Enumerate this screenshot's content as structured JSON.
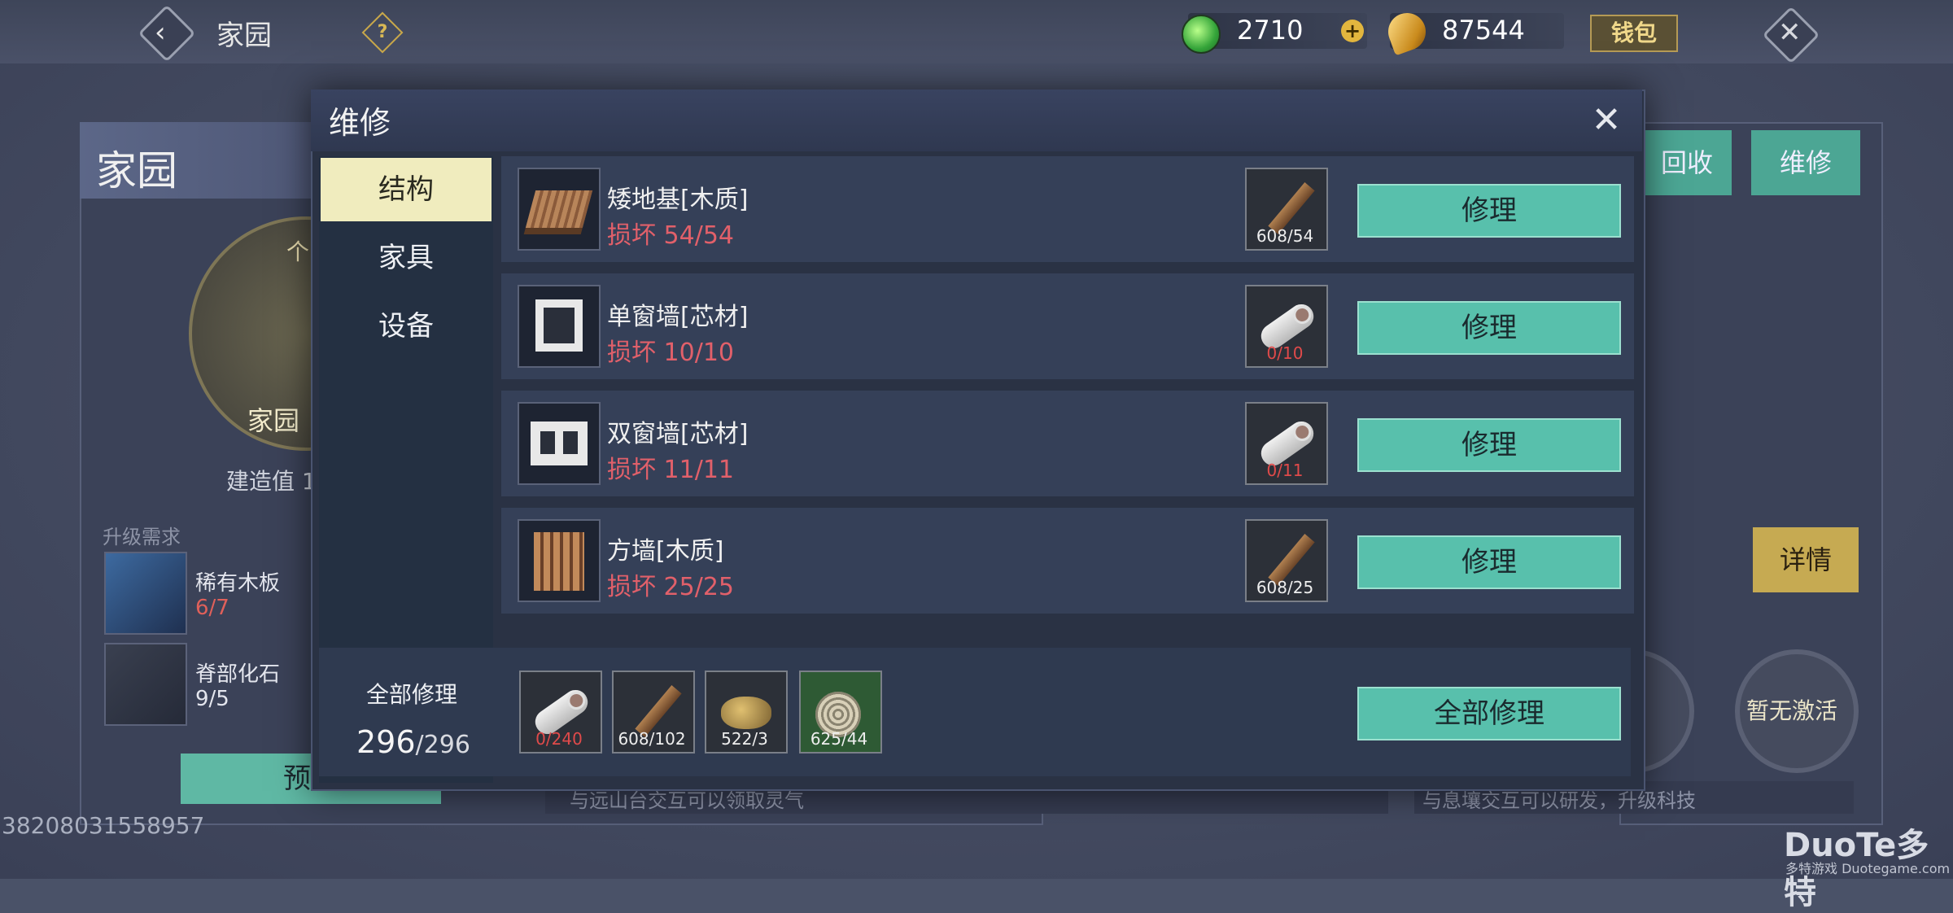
{
  "topbar": {
    "title": "家园",
    "help": "?",
    "jade": "2710",
    "add": "+",
    "coins": "87544",
    "wallet": "钱包",
    "close": "✕"
  },
  "home_panel": {
    "title": "家园",
    "emblem_top": "个",
    "emblem_label": "家园",
    "build_value": "建造值 1",
    "upgrade_req": "升级需求",
    "materials": [
      {
        "name": "稀有木板",
        "count": "6/7"
      },
      {
        "name": "脊部化石",
        "count": "9/5"
      }
    ],
    "preview_button": "预览",
    "player_id": "38208031558957"
  },
  "right_panel": {
    "recycle": "回收",
    "repair": "维修",
    "detail": "详情",
    "inactive_1": "激活",
    "inactive_2": "暂无激活",
    "hint_left": "与远山台交互可以领取灵气",
    "hint_right": "与息壤交互可以研发，升级科技"
  },
  "modal": {
    "title": "维修",
    "close": "✕",
    "tabs": [
      "结构",
      "家具",
      "设备"
    ],
    "active_tab": "结构",
    "items": [
      {
        "name": "矮地基[木质]",
        "damage": "损坏 54/54",
        "mat_count": "608/54",
        "mat_red": false,
        "button": "修理"
      },
      {
        "name": "单窗墙[芯材]",
        "damage": "损坏 10/10",
        "mat_count": "0/10",
        "mat_red": true,
        "button": "修理"
      },
      {
        "name": "双窗墙[芯材]",
        "damage": "损坏 11/11",
        "mat_count": "0/11",
        "mat_red": true,
        "button": "修理"
      },
      {
        "name": "方墙[木质]",
        "damage": "损坏 25/25",
        "mat_count": "608/25",
        "mat_red": false,
        "button": "修理"
      }
    ],
    "repair_all": {
      "label": "全部修理",
      "current": "296",
      "total": "/296",
      "materials": [
        {
          "icon": "core-log-icon",
          "count": "0/240",
          "red": true
        },
        {
          "icon": "wood-plank-icon",
          "count": "608/102",
          "red": false
        },
        {
          "icon": "stone-ore-icon",
          "count": "522/3",
          "red": false
        },
        {
          "icon": "rope-coil-icon",
          "count": "625/44",
          "red": false
        }
      ],
      "button": "全部修理"
    }
  },
  "watermark": {
    "brand": "DuoTe多特",
    "sub": "多特游戏 Duotegame.com"
  },
  "colors": {
    "accent": "#58c0ac",
    "damage": "#e1606a",
    "tab_active": "#f0ecbe",
    "gold": "#c6aa52"
  }
}
